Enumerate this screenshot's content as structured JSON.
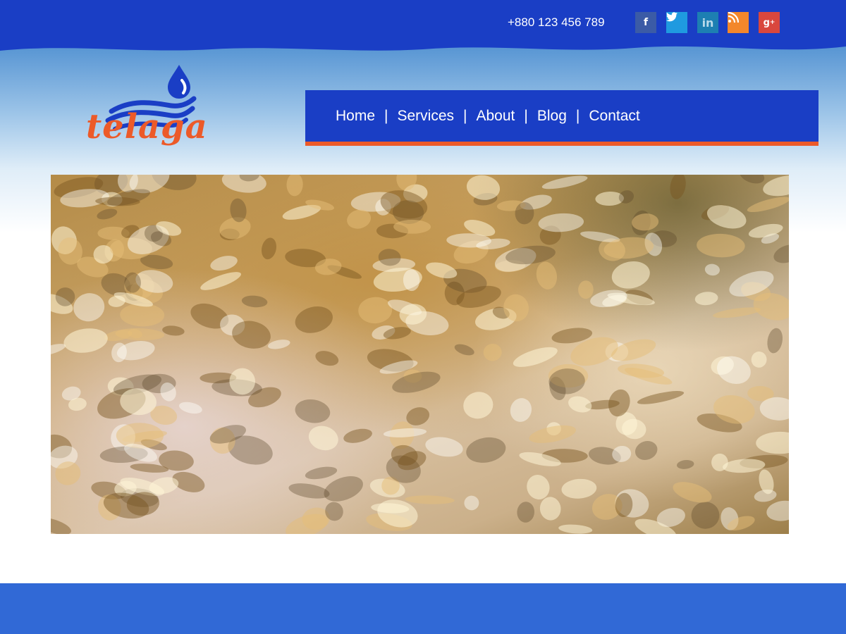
{
  "header": {
    "phone": "+880 123 456 789",
    "social": [
      {
        "name": "facebook",
        "glyph": "f",
        "icon": "facebook-icon",
        "color": "#3b5ba6"
      },
      {
        "name": "twitter",
        "glyph": "🐦",
        "icon": "twitter-icon",
        "color": "#1f9ae0"
      },
      {
        "name": "linkedin",
        "glyph": "in",
        "icon": "linkedin-icon",
        "color": "#1d7fb2"
      },
      {
        "name": "rss",
        "glyph": "◉",
        "icon": "rss-icon",
        "color": "#f3872b"
      },
      {
        "name": "google-plus",
        "glyph": "g+",
        "icon": "google-plus-icon",
        "color": "#d9473d"
      }
    ]
  },
  "logo": {
    "text": "telaga"
  },
  "nav": {
    "items": [
      "Home",
      "Services",
      "About",
      "Blog",
      "Contact"
    ],
    "separator": "|"
  },
  "colors": {
    "header": "#1a3ec5",
    "accent": "#ec5a29",
    "footer": "#3169d6"
  }
}
